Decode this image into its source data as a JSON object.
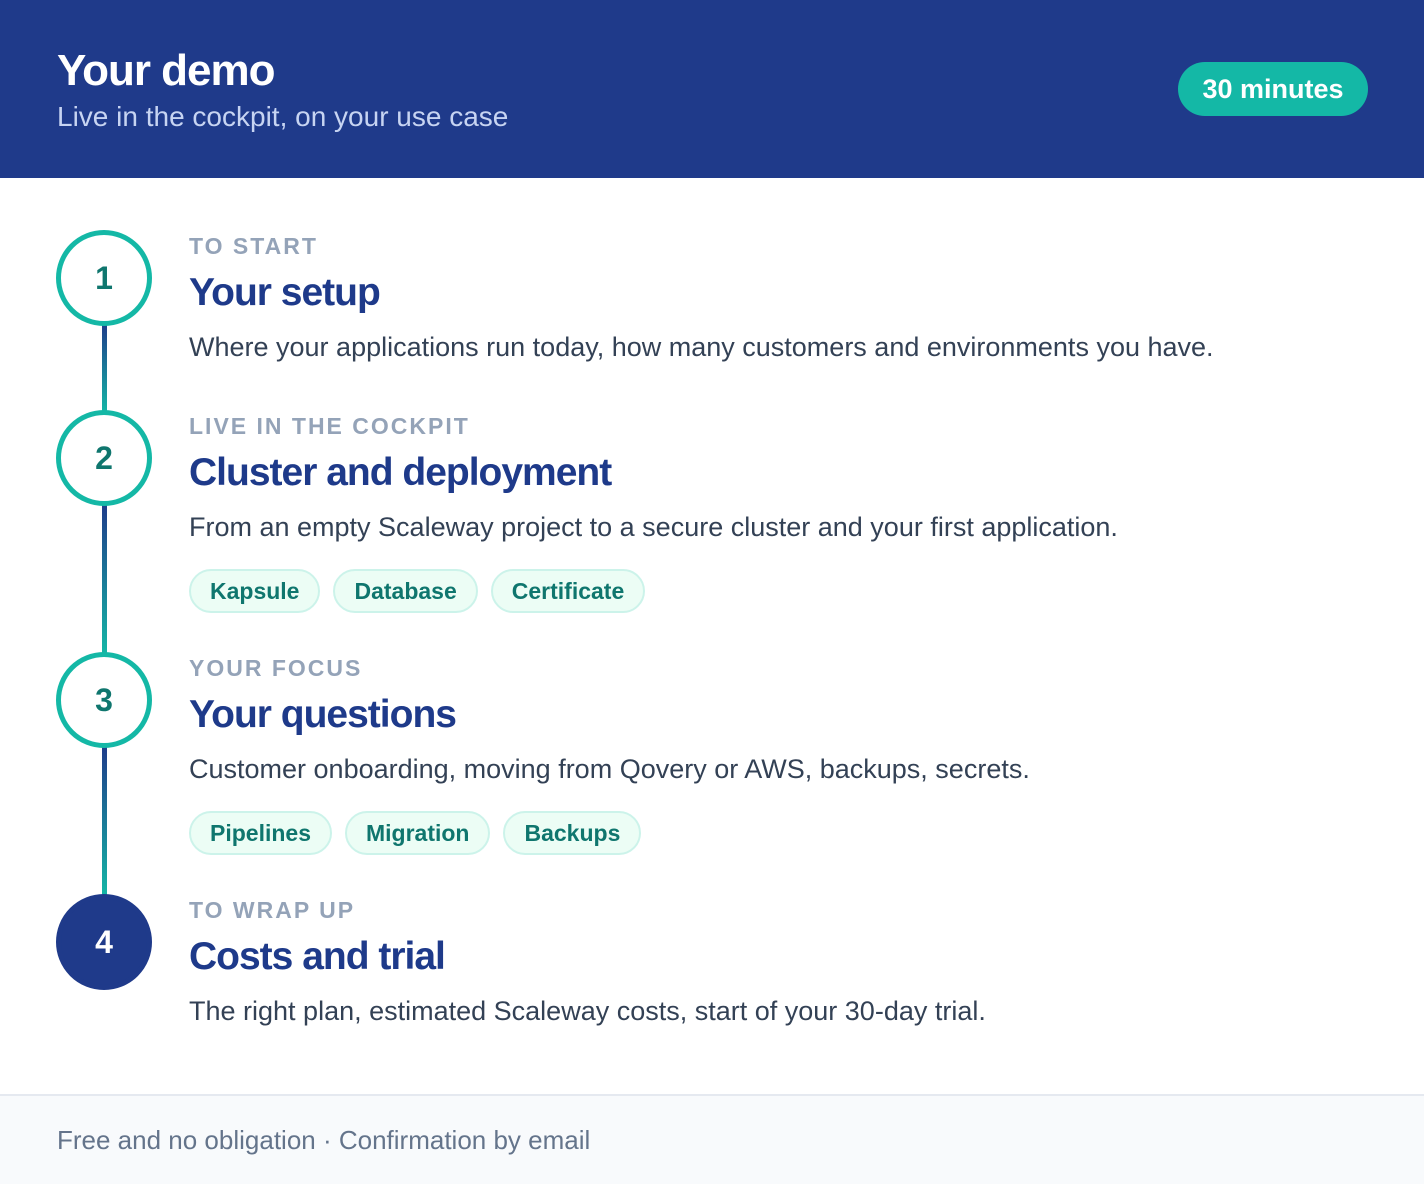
{
  "header": {
    "title": "Your demo",
    "subtitle": "Live in the cockpit, on your use case",
    "duration_badge": "30 minutes"
  },
  "colors": {
    "brand_navy": "#1f3a8a",
    "accent_teal": "#14b8a6",
    "tag_text": "#0f766e",
    "tag_bg": "#ecfdf5"
  },
  "steps": [
    {
      "number": "1",
      "eyebrow": "TO START",
      "title": "Your setup",
      "description": "Where your applications run today, how many customers and environments you have.",
      "tags": []
    },
    {
      "number": "2",
      "eyebrow": "LIVE IN THE COCKPIT",
      "title": "Cluster and deployment",
      "description": "From an empty Scaleway project to a secure cluster and your first application.",
      "tags": [
        "Kapsule",
        "Database",
        "Certificate"
      ]
    },
    {
      "number": "3",
      "eyebrow": "YOUR FOCUS",
      "title": "Your questions",
      "description": "Customer onboarding, moving from Qovery or AWS, backups, secrets.",
      "tags": [
        "Pipelines",
        "Migration",
        "Backups"
      ]
    },
    {
      "number": "4",
      "eyebrow": "TO WRAP UP",
      "title": "Costs and trial",
      "description": "The right plan, estimated Scaleway costs, start of your 30-day trial.",
      "tags": []
    }
  ],
  "footer": {
    "text": "Free and no obligation · Confirmation by email"
  }
}
